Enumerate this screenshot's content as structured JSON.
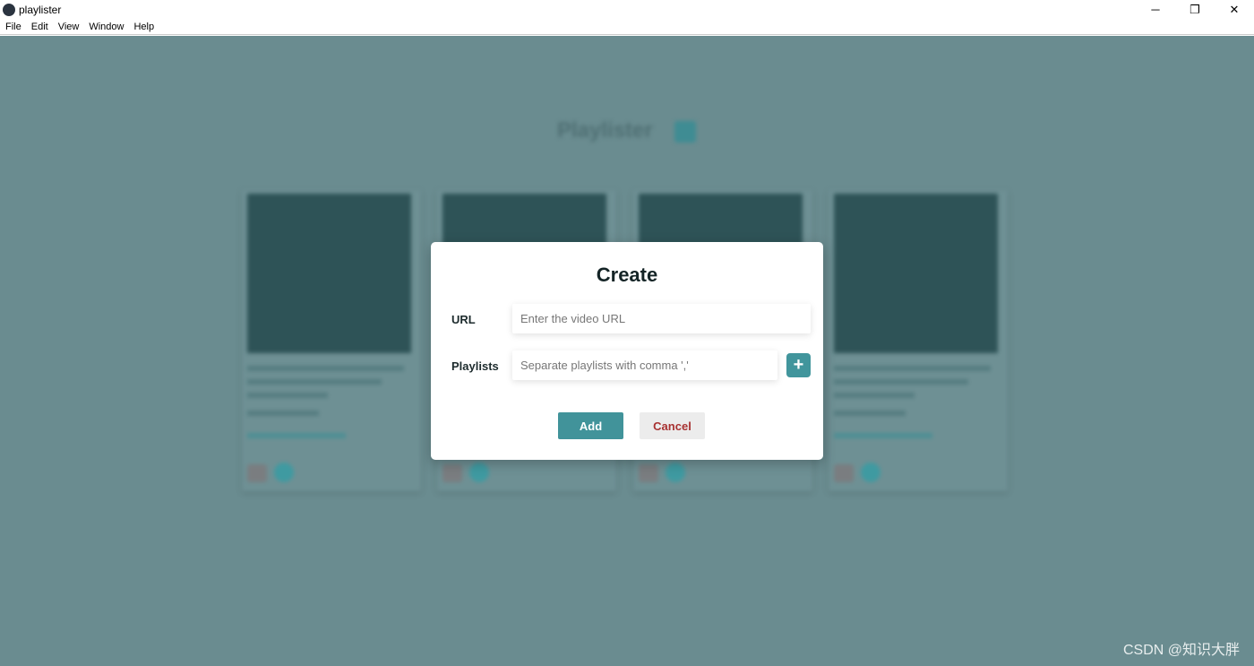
{
  "window": {
    "title": "playlister",
    "minimize": "─",
    "maximize": "❐",
    "close": "✕"
  },
  "menu": [
    "File",
    "Edit",
    "View",
    "Window",
    "Help"
  ],
  "background": {
    "title": "Playlister",
    "card_count": 4
  },
  "dialog": {
    "title": "Create",
    "url_label": "URL",
    "url_placeholder": "Enter the video URL",
    "url_value": "",
    "playlists_label": "Playlists",
    "playlists_placeholder": "Separate playlists with comma ','",
    "playlists_value": "",
    "plus": "+",
    "add": "Add",
    "cancel": "Cancel"
  },
  "colors": {
    "accent": "#41939a",
    "cancel_text": "#a83232",
    "overlay": "#6a8c90"
  },
  "watermark": "CSDN @知识大胖"
}
